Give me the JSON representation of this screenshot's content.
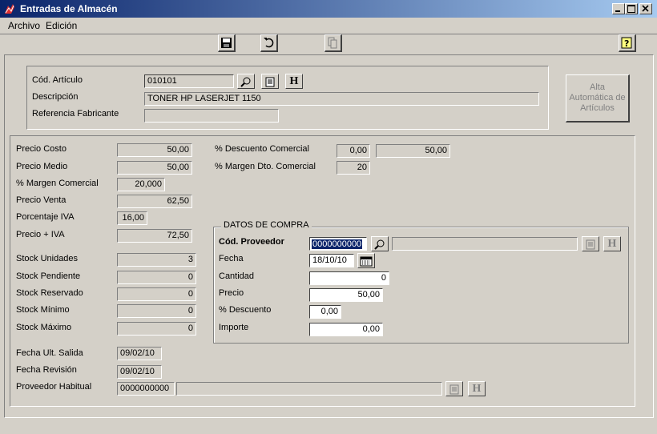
{
  "window": {
    "title": "Entradas de Almacén"
  },
  "menu": [
    {
      "label": "Archivo"
    },
    {
      "label": "Edición"
    }
  ],
  "articulo": {
    "cod_label": "Cód. Artículo",
    "cod_value": "010101",
    "desc_label": "Descripción",
    "desc_value": "TONER HP LASERJET 1150",
    "ref_label": "Referencia Fabricante",
    "ref_value": ""
  },
  "alta_button": "Alta Automática de Artículos",
  "precios": {
    "precio_costo": {
      "label": "Precio Costo",
      "value": "50,00"
    },
    "precio_medio": {
      "label": "Precio Medio",
      "value": "50,00"
    },
    "margen_comercial": {
      "label": "% Margen Comercial",
      "value": "20,000"
    },
    "precio_venta": {
      "label": "Precio Venta",
      "value": "62,50"
    },
    "porcentaje_iva": {
      "label": "Porcentaje IVA",
      "value": "16,00"
    },
    "precio_iva": {
      "label": "Precio + IVA",
      "value": "72,50"
    }
  },
  "descuento": {
    "label": "% Descuento Comercial",
    "pct": "0,00",
    "value": "50,00",
    "margen_label": "% Margen Dto. Comercial",
    "margen_value": "20"
  },
  "stock": {
    "unidades": {
      "label": "Stock Unidades",
      "value": "3"
    },
    "pendiente": {
      "label": "Stock Pendiente",
      "value": "0"
    },
    "reservado": {
      "label": "Stock Reservado",
      "value": "0"
    },
    "minimo": {
      "label": "Stock Mínimo",
      "value": "0"
    },
    "maximo": {
      "label": "Stock Máximo",
      "value": "0"
    }
  },
  "fechas": {
    "ult_salida": {
      "label": "Fecha Ult. Salida",
      "value": "09/02/10"
    },
    "revision": {
      "label": "Fecha Revisión",
      "value": "09/02/10"
    }
  },
  "proveedor_habitual": {
    "label": "Proveedor Habitual",
    "code": "0000000000",
    "name": ""
  },
  "compra": {
    "title": "DATOS DE COMPRA",
    "proveedor_label": "Cód. Proveedor",
    "proveedor_value": "0000000000",
    "proveedor_name": "",
    "fecha_label": "Fecha",
    "fecha_value": "18/10/10",
    "cantidad_label": "Cantidad",
    "cantidad_value": "0",
    "precio_label": "Precio",
    "precio_value": "50,00",
    "descuento_label": "% Descuento",
    "descuento_value": "0,00",
    "importe_label": "Importe",
    "importe_value": "0,00"
  },
  "icons": {
    "h_glyph": "H"
  }
}
